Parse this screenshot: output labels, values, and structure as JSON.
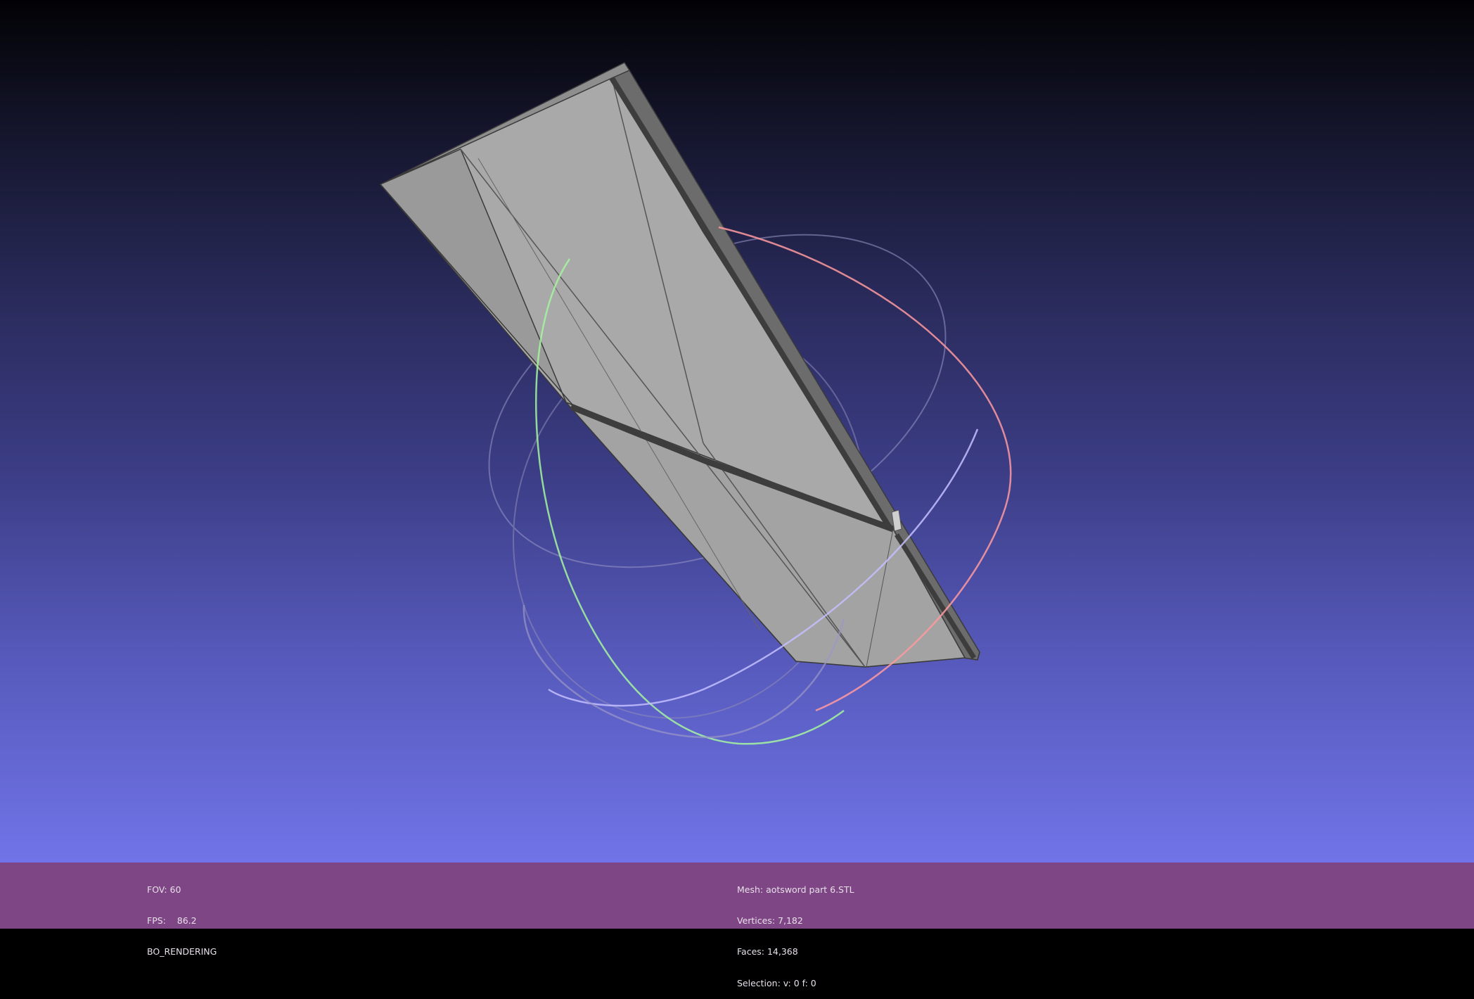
{
  "viewport": {
    "background_top": "#020205",
    "background_bottom": "#7074e8",
    "mesh_color": "#a9a9a9",
    "trackball_colors": {
      "x_ring": "#ff9aa0",
      "y_ring": "#a4f5a0",
      "z_ring": "#b9b5ff"
    }
  },
  "info_bar": {
    "background": "#7e4684",
    "left": {
      "fov": "FOV: 60",
      "fps": "FPS:    86.2",
      "render_mode": "BO_RENDERING"
    },
    "right": {
      "mesh": "Mesh: aotsword part 6.STL",
      "vertices": "Vertices: 7,182",
      "faces": "Faces: 14,368",
      "selection": "Selection: v: 0 f: 0"
    }
  }
}
